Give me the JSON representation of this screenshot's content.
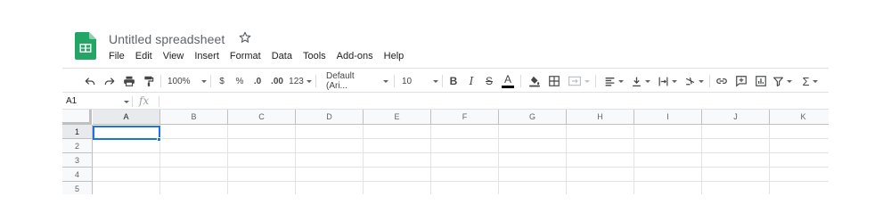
{
  "app": {
    "title": "Untitled spreadsheet",
    "brand_color": "#188038"
  },
  "menu": [
    "File",
    "Edit",
    "View",
    "Insert",
    "Format",
    "Data",
    "Tools",
    "Add-ons",
    "Help"
  ],
  "toolbar": {
    "zoom": "100%",
    "currency": "$",
    "percent": "%",
    "decrease_decimal": ".0",
    "increase_decimal": ".00",
    "more_formats": "123",
    "font_family": "Default (Ari...",
    "font_size": "10",
    "bold": "B",
    "italic": "I",
    "strikethrough": "S",
    "text_color_glyph": "A",
    "function_glyph": "Σ",
    "icons": [
      "undo-icon",
      "redo-icon",
      "print-icon",
      "paint-format-icon",
      "fill-color-icon",
      "borders-icon",
      "merge-cells-icon",
      "horizontal-align-icon",
      "vertical-align-icon",
      "text-wrapping-icon",
      "text-rotation-icon",
      "insert-link-icon",
      "insert-comment-icon",
      "insert-chart-icon",
      "filter-icon",
      "functions-icon"
    ]
  },
  "formula_bar": {
    "name_box": "A1",
    "fx": "fx",
    "content": ""
  },
  "grid": {
    "columns": [
      "A",
      "B",
      "C",
      "D",
      "E",
      "F",
      "G",
      "H",
      "I",
      "J",
      "K"
    ],
    "rows": [
      "1",
      "2",
      "3",
      "4",
      "5"
    ],
    "selected_cell": "A1",
    "selection_color": "#1a73e8"
  }
}
